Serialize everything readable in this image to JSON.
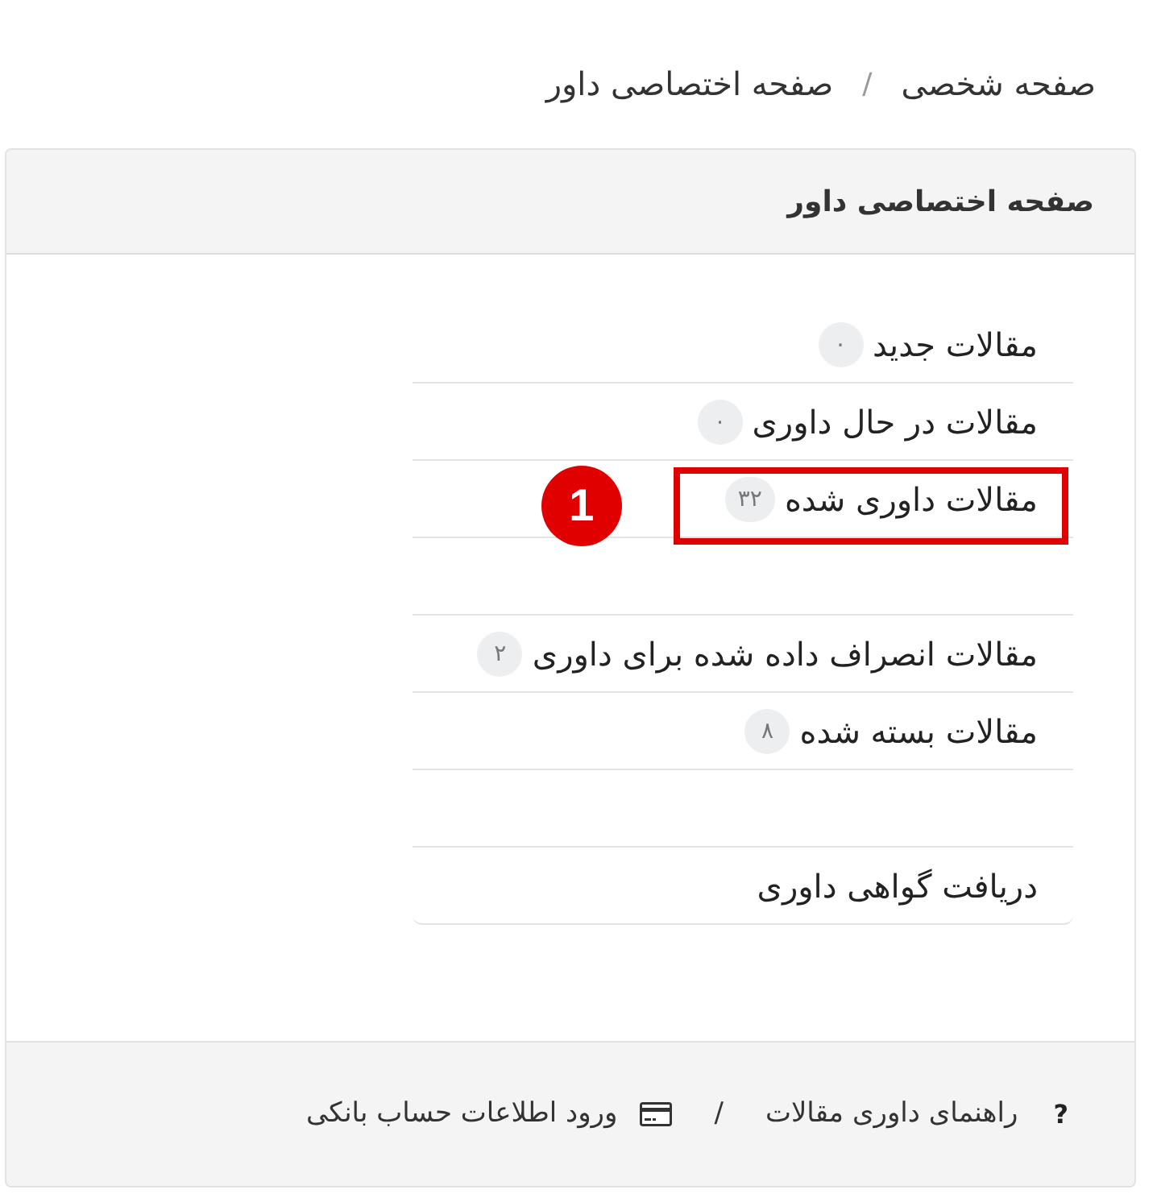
{
  "breadcrumb": {
    "items": [
      {
        "label": "صفحه شخصی"
      },
      {
        "label": "صفحه اختصاصی داور"
      }
    ],
    "separator": "/"
  },
  "card": {
    "title": "صفحه اختصاصی داور",
    "items": [
      {
        "kind": "link",
        "label": "مقالات جدید",
        "count": "۰",
        "highlighted": false
      },
      {
        "kind": "link",
        "label": "مقالات در حال داوری",
        "count": "۰",
        "highlighted": false
      },
      {
        "kind": "link",
        "label": "مقالات داوری شده",
        "count": "۳۲",
        "highlighted": true,
        "callout": "1"
      },
      {
        "kind": "blank",
        "highlighted": false
      },
      {
        "kind": "link",
        "label": "مقالات انصراف داده شده برای داوری",
        "count": "۲",
        "highlighted": false
      },
      {
        "kind": "link",
        "label": "مقالات بسته شده",
        "count": "۸",
        "highlighted": false
      },
      {
        "kind": "blank",
        "highlighted": false
      },
      {
        "kind": "link",
        "label": "دریافت گواهی داوری",
        "highlighted": false
      }
    ]
  },
  "footer": {
    "links": [
      {
        "kind": "help",
        "icon_text": "?",
        "label": "راهنمای داوری مقالات"
      },
      {
        "kind": "card",
        "label": "ورود اطلاعات حساب بانکی"
      }
    ],
    "separator": "/"
  }
}
